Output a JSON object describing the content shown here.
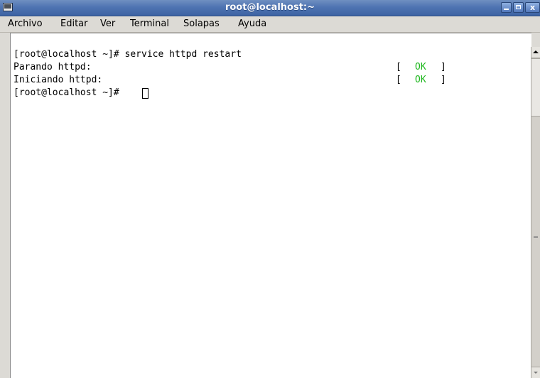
{
  "window": {
    "title": "root@localhost:~",
    "colors": {
      "titlebar": "#4f74b2",
      "ok_green": "#20b820",
      "terminal_bg": "#ffffff"
    }
  },
  "menu": {
    "items": [
      {
        "label": "Archivo"
      },
      {
        "label": "Editar"
      },
      {
        "label": "Ver"
      },
      {
        "label": "Terminal"
      },
      {
        "label": "Solapas"
      },
      {
        "label": "Ayuda"
      }
    ]
  },
  "terminal": {
    "lines": [
      {
        "text": "[root@localhost ~]# service httpd restart"
      },
      {
        "text": "Parando httpd:",
        "status": {
          "open": "[",
          "value": "OK",
          "close": "]"
        }
      },
      {
        "text": "Iniciando httpd:",
        "status": {
          "open": "[",
          "value": "OK",
          "close": "]"
        }
      },
      {
        "text": "[root@localhost ~]# "
      }
    ]
  }
}
